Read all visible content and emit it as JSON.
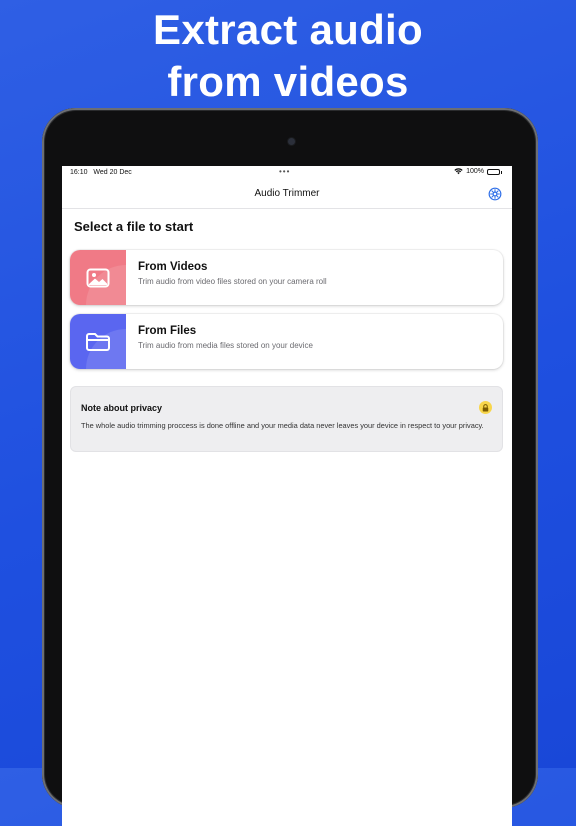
{
  "promo": {
    "line1": "Extract audio",
    "line2": "from videos"
  },
  "status_bar": {
    "time": "16:10",
    "date": "Wed 20 Dec",
    "dots": "•••",
    "battery": "100%"
  },
  "nav": {
    "title": "Audio Trimmer",
    "settings_icon": "settings-icon"
  },
  "main": {
    "section_title": "Select a file to start",
    "sources": [
      {
        "title": "From Videos",
        "subtitle": "Trim audio from video files stored on your camera roll",
        "icon": "photo-icon",
        "color": "#f07a86"
      },
      {
        "title": "From Files",
        "subtitle": "Trim audio from media files stored on your device",
        "icon": "folder-icon",
        "color": "#5a66f0"
      }
    ],
    "privacy": {
      "title": "Note about privacy",
      "text": "The whole audio trimming proccess is done offline and your media data never leaves your device in respect to your privacy.",
      "icon": "lock-icon"
    }
  },
  "colors": {
    "background": "#2253e0",
    "accent": "#2f6fe8",
    "lock": "#f8d64b"
  }
}
